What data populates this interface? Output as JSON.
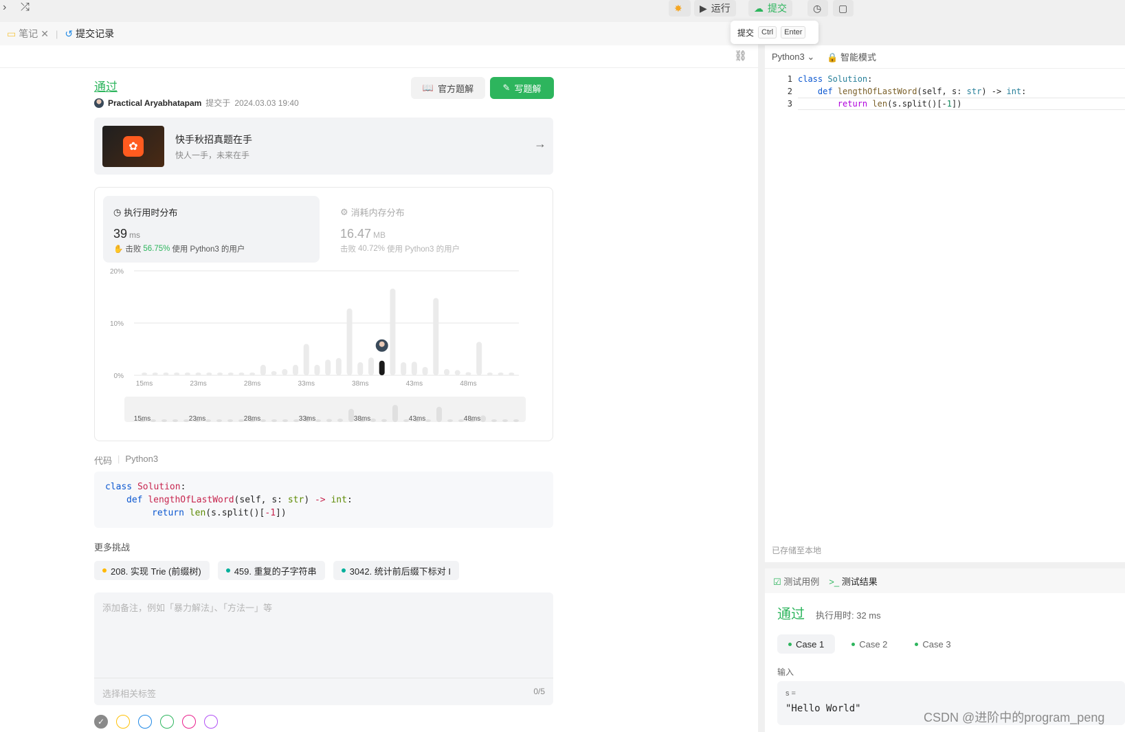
{
  "topbar": {
    "run_label": "运行",
    "submit_label": "提交",
    "tip": {
      "label": "提交",
      "key1": "Ctrl",
      "key2": "Enter"
    }
  },
  "tabs": {
    "notes": "笔记",
    "submissions": "提交记录"
  },
  "submission": {
    "status": "通过",
    "user": "Practical Aryabhatapam",
    "submitted_prefix": "提交于",
    "time": "2024.03.03 19:40",
    "btn_official": "官方题解",
    "btn_write": "写题解"
  },
  "banner": {
    "title": "快手秋招真题在手",
    "subtitle": "快人一手，未来在手"
  },
  "stats": {
    "time_card": {
      "title": "执行用时分布",
      "value": "39",
      "unit": "ms",
      "beat_prefix": "击败",
      "beat_pct": "56.75%",
      "beat_suffix": "使用 Python3 的用户"
    },
    "mem_card": {
      "title": "消耗内存分布",
      "value": "16.47",
      "unit": "MB",
      "beat_prefix": "击败",
      "beat_pct": "40.72%",
      "beat_suffix": "使用 Python3 的用户"
    }
  },
  "chart_data": {
    "type": "bar",
    "y_ticks": [
      "20%",
      "10%",
      "0%"
    ],
    "x_tick_labels": [
      "15ms",
      "23ms",
      "28ms",
      "33ms",
      "38ms",
      "43ms",
      "48ms"
    ],
    "ylim": [
      0,
      20
    ],
    "values": [
      0.4,
      0.4,
      0.4,
      0.4,
      0.4,
      0.4,
      0.4,
      0.4,
      0.4,
      0.4,
      0.4,
      2.0,
      0.8,
      1.2,
      2.0,
      6.0,
      2.0,
      3.0,
      3.3,
      12.8,
      2.5,
      3.4,
      2.8,
      16.6,
      2.5,
      2.6,
      1.6,
      14.8,
      1.2,
      1.0,
      0.6,
      6.4,
      0.5,
      0.5,
      0.5
    ],
    "highlight_index": 22,
    "colors": {
      "bar": "#ebebeb",
      "highlight": "#1a1a1a",
      "grid": "#e6e6e6"
    }
  },
  "code_section": {
    "label": "代码",
    "lang": "Python3",
    "lines": [
      "class Solution:",
      "    def lengthOfLastWord(self, s: str) -> int:",
      "        return len(s.split()[-1])"
    ]
  },
  "more": {
    "label": "更多挑战",
    "chips": [
      {
        "text": "208. 实现 Trie (前缀树)",
        "color": "#ffb800"
      },
      {
        "text": "459. 重复的子字符串",
        "color": "#00af9b"
      },
      {
        "text": "3042. 统计前后缀下标对 I",
        "color": "#00af9b"
      }
    ]
  },
  "note": {
    "placeholder": "添加备注，例如「暴力解法」、「方法一」等",
    "tag_placeholder": "选择相关标签",
    "count": "0/5",
    "colors": [
      "#8a8a8a",
      "#ffc107",
      "#1e88e5",
      "#2db55d",
      "#e91e8c",
      "#b14ff5"
    ]
  },
  "editor": {
    "lang": "Python3",
    "mode": "智能模式",
    "saved": "已存储至本地",
    "line_numbers": [
      "1",
      "2",
      "3"
    ]
  },
  "results": {
    "tab_cases": "测试用例",
    "tab_result": "测试结果",
    "status": "通过",
    "time": "执行用时: 32 ms",
    "cases": [
      "Case 1",
      "Case 2",
      "Case 3"
    ],
    "input_label": "输入",
    "var": "s =",
    "value": "\"Hello World\""
  },
  "watermark": "CSDN @进阶中的program_peng"
}
